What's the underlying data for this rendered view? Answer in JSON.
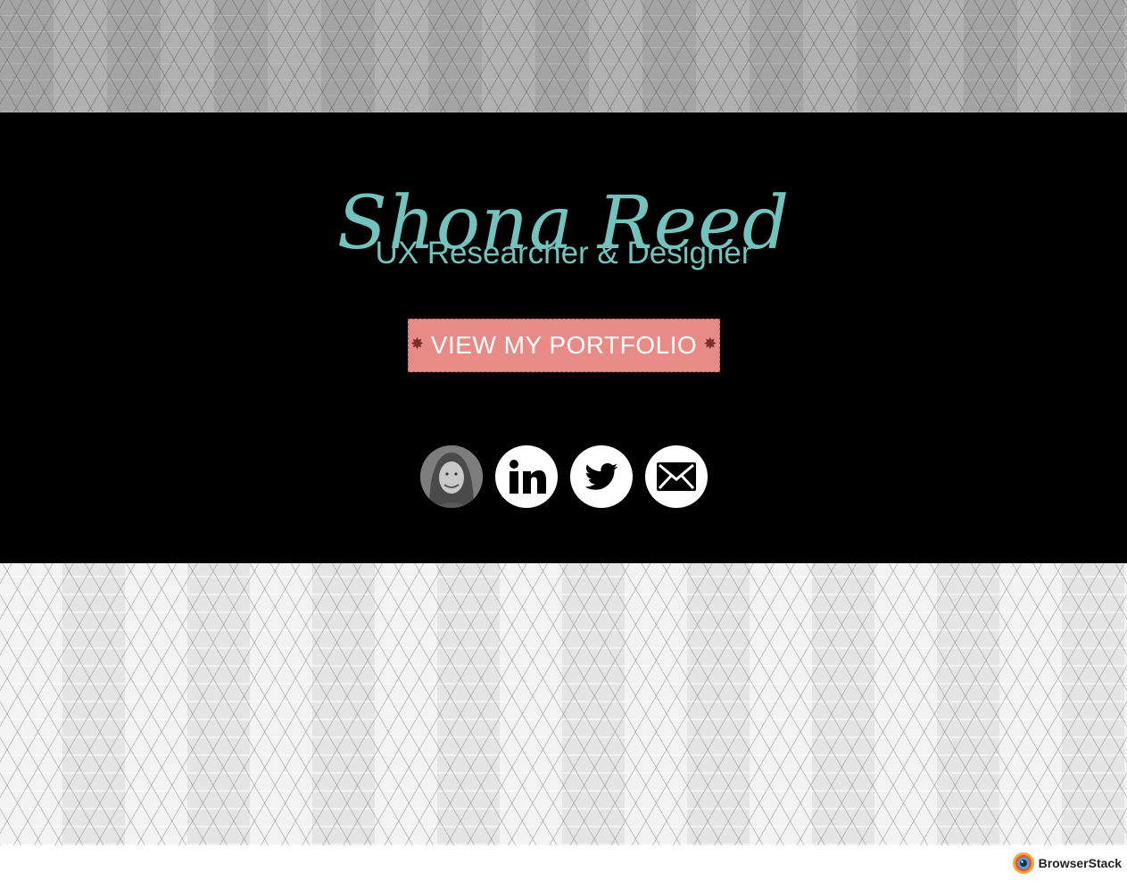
{
  "hero": {
    "name": "Shona Reed",
    "tagline": "UX Researcher & Designer",
    "portfolio_label": "VIEW MY PORTFOLIO"
  },
  "socials": [
    {
      "name": "avatar",
      "label": "Shona Reed photo"
    },
    {
      "name": "linkedin-icon",
      "label": "LinkedIn"
    },
    {
      "name": "twitter-icon",
      "label": "Twitter"
    },
    {
      "name": "mail-icon",
      "label": "Email"
    }
  ],
  "footer": {
    "brand": "BrowserStack"
  },
  "colors": {
    "accent": "#72c2bd",
    "button": "#e88a86",
    "hero_bg": "#000000"
  }
}
